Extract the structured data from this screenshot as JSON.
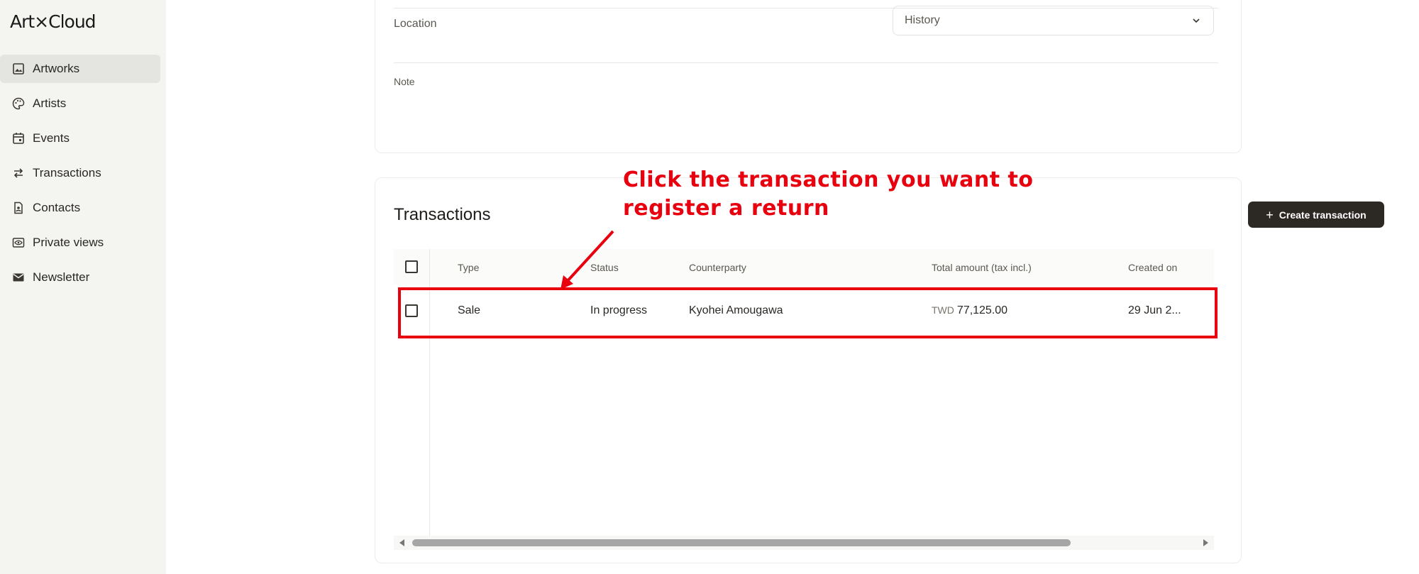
{
  "app": {
    "logo": "Art×Cloud"
  },
  "sidebar": {
    "items": [
      {
        "label": "Artworks",
        "icon": "image-icon",
        "active": true
      },
      {
        "label": "Artists",
        "icon": "palette-icon",
        "active": false
      },
      {
        "label": "Events",
        "icon": "calendar-icon",
        "active": false
      },
      {
        "label": "Transactions",
        "icon": "swap-icon",
        "active": false
      },
      {
        "label": "Contacts",
        "icon": "contact-icon",
        "active": false
      },
      {
        "label": "Private views",
        "icon": "eye-icon",
        "active": false
      },
      {
        "label": "Newsletter",
        "icon": "mail-icon",
        "active": false
      }
    ]
  },
  "details": {
    "location_label": "Location",
    "location_value": "History",
    "note_label": "Note"
  },
  "transactions": {
    "title": "Transactions",
    "create_button": "Create transaction",
    "columns": [
      "Type",
      "Status",
      "Counterparty",
      "Total amount (tax incl.)",
      "Created on"
    ],
    "rows": [
      {
        "type": "Sale",
        "status": "In progress",
        "counterparty": "Kyohei Amougawa",
        "currency": "TWD",
        "amount": "77,125.00",
        "created_on": "29 Jun 2..."
      }
    ]
  },
  "annotation": {
    "text_line1": "Click the transaction you want to",
    "text_line2": "register a return",
    "color": "#e8000f"
  }
}
